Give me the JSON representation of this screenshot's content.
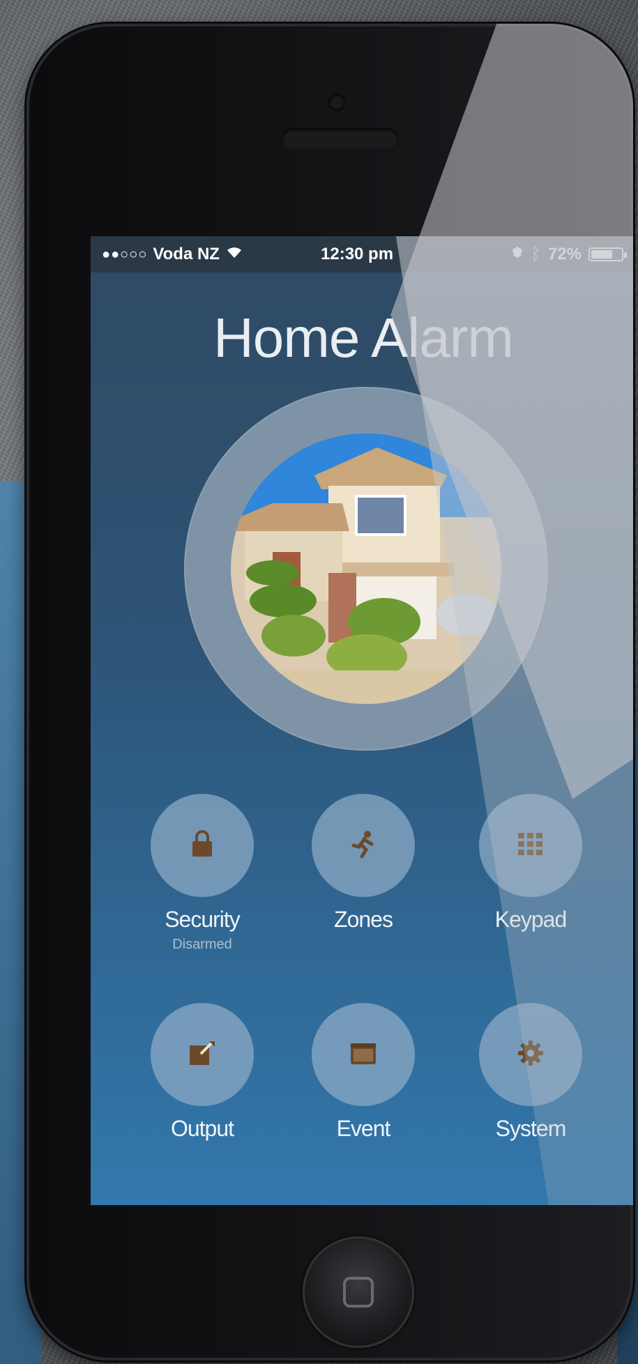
{
  "status_bar": {
    "carrier": "Voda NZ",
    "time": "12:30 pm",
    "battery_percent": "72%",
    "battery_level": 0.72
  },
  "app": {
    "title": "Home Alarm"
  },
  "menu": [
    {
      "label": "Security",
      "sublabel": "Disarmed",
      "icon": "lock-icon"
    },
    {
      "label": "Zones",
      "icon": "running-person-icon"
    },
    {
      "label": "Keypad",
      "icon": "keypad-icon"
    },
    {
      "label": "Output",
      "icon": "edit-output-icon"
    },
    {
      "label": "Event",
      "icon": "calendar-icon"
    },
    {
      "label": "System",
      "icon": "gear-icon"
    }
  ],
  "colors": {
    "icon_brown": "#6b4a2a",
    "tile_circle": "#8caac4",
    "screen_top": "#2f4a63",
    "screen_bottom": "#3278ad"
  }
}
